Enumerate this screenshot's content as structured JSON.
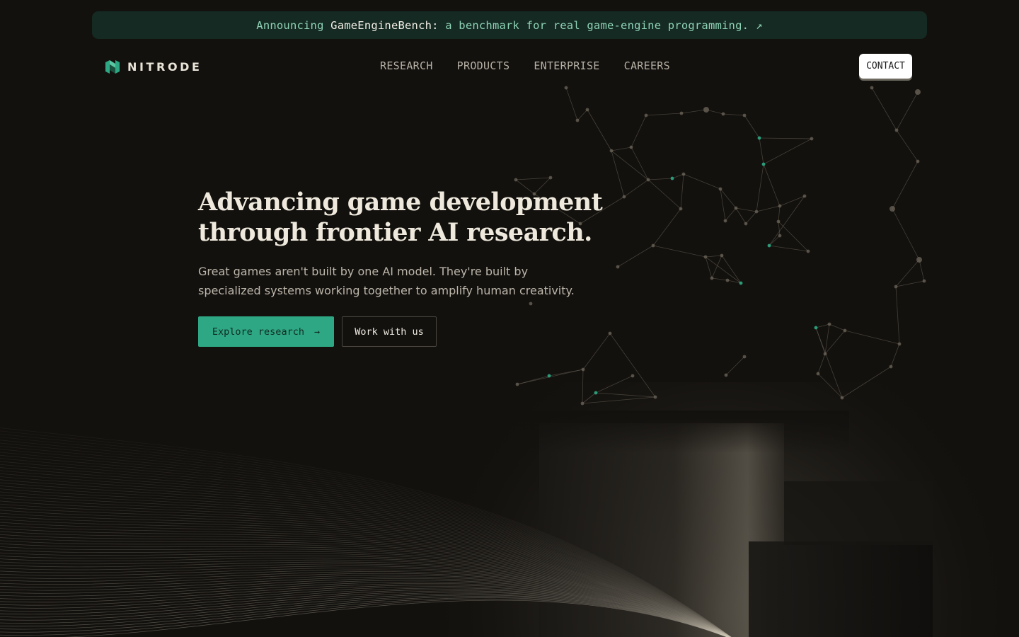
{
  "announcement": {
    "prefix": "Announcing",
    "product": "GameEngineBench:",
    "text": "a benchmark for real game-engine programming.",
    "arrow": "↗"
  },
  "brand": {
    "name": "NITRODE",
    "logo_icon": "nitrode-logo-icon",
    "accent": "#2ea884"
  },
  "nav": {
    "items": [
      "RESEARCH",
      "PRODUCTS",
      "ENTERPRISE",
      "CAREERS"
    ],
    "contact": "CONTACT"
  },
  "hero": {
    "title_line1": "Advancing game development",
    "title_line2": "through frontier AI research.",
    "sub_line1": "Great games aren't built by one AI model. They're built by",
    "sub_line2": "specialized systems working together to amplify human creativity.",
    "primary_button": "Explore research",
    "primary_arrow": "→",
    "secondary_button": "Work with us"
  },
  "colors": {
    "background": "#13110e",
    "banner": "#152a23",
    "accent": "#2ea884",
    "node": "#6e665a"
  }
}
